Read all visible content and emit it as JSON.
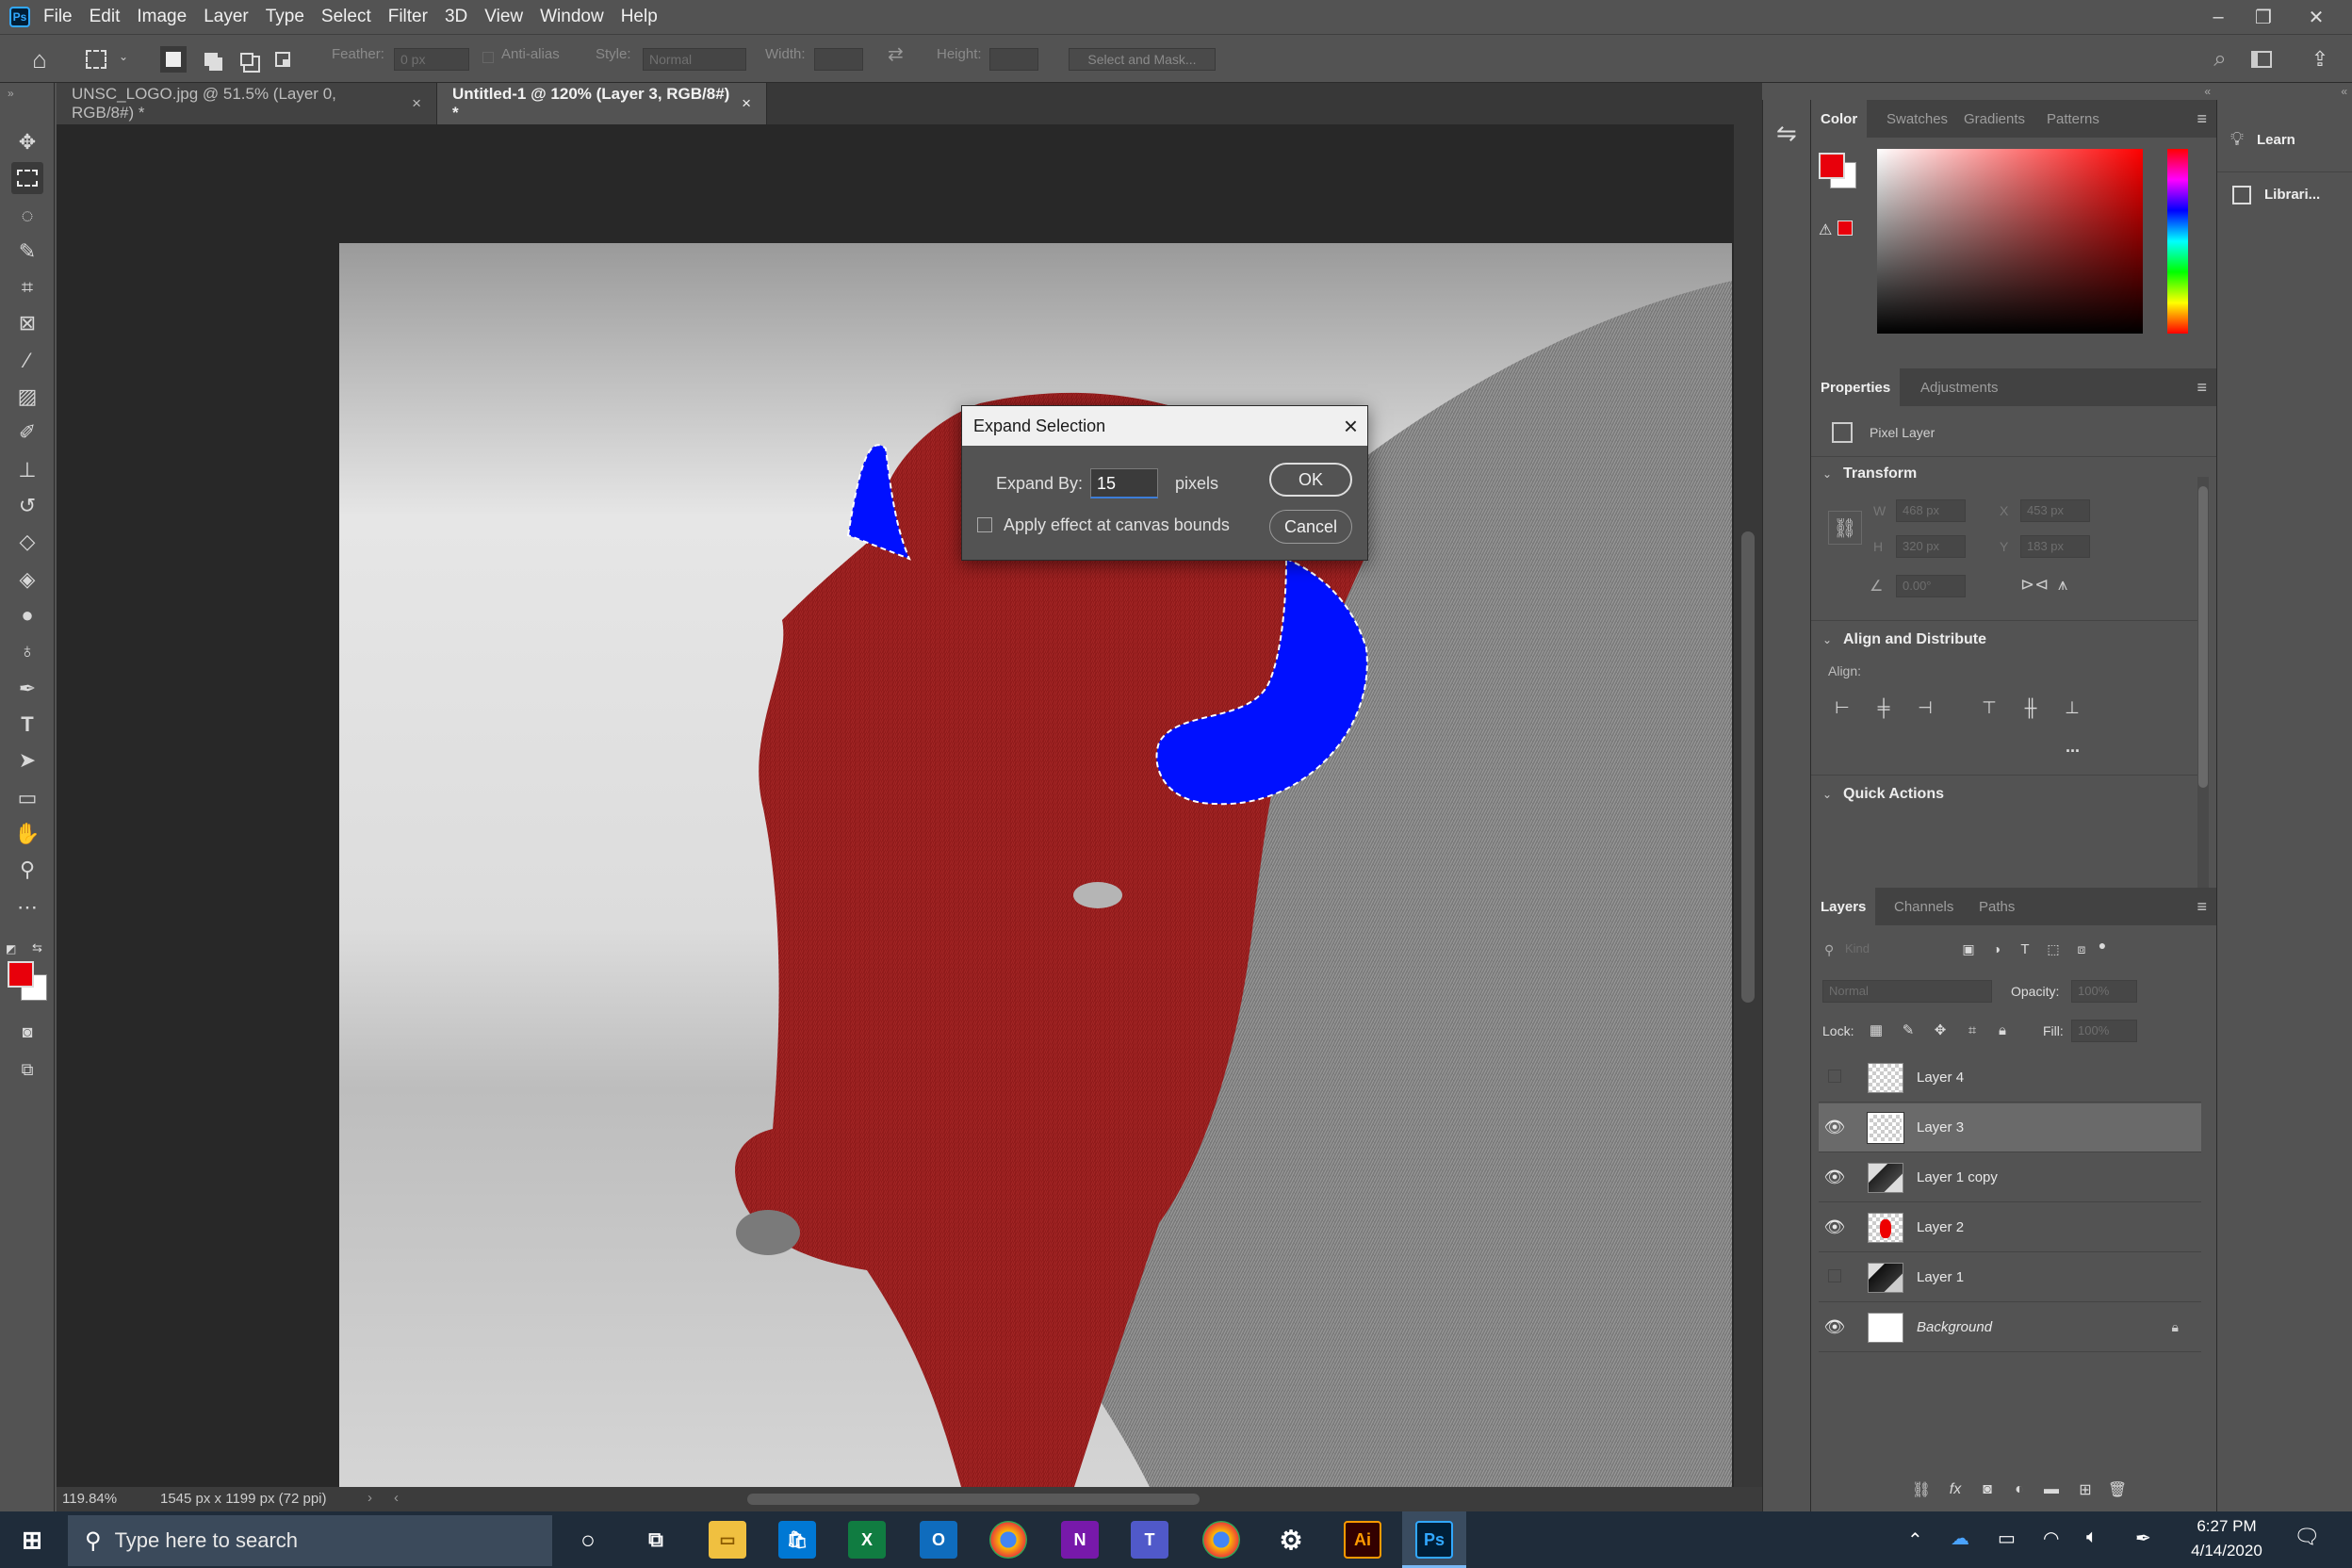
{
  "app": {
    "icon_text": "Ps"
  },
  "menu": [
    "File",
    "Edit",
    "Image",
    "Layer",
    "Type",
    "Select",
    "Filter",
    "3D",
    "View",
    "Window",
    "Help"
  ],
  "options": {
    "feather_label": "Feather:",
    "feather_value": "0 px",
    "antialias_label": "Anti-alias",
    "style_label": "Style:",
    "style_value": "Normal",
    "width_label": "Width:",
    "height_label": "Height:",
    "select_mask": "Select and Mask..."
  },
  "tabs": [
    {
      "label": "UNSC_LOGO.jpg @ 51.5% (Layer 0, RGB/8#) *",
      "close": "×"
    },
    {
      "label": "Untitled-1 @ 120% (Layer 3, RGB/8#) *",
      "close": "×"
    }
  ],
  "status": {
    "zoom": "119.84%",
    "doc_info": "1545 px x 1199 px (72 ppi)"
  },
  "dialog": {
    "title": "Expand Selection",
    "expand_label": "Expand By:",
    "expand_value": "15",
    "unit": "pixels",
    "checkbox_label": "Apply effect at canvas bounds",
    "ok": "OK",
    "cancel": "Cancel"
  },
  "color_panel": {
    "tabs": [
      "Color",
      "Swatches",
      "Gradients",
      "Patterns"
    ],
    "foreground": "#e8000b",
    "background": "#ffffff"
  },
  "properties": {
    "tabs": [
      "Properties",
      "Adjustments"
    ],
    "kind": "Pixel Layer",
    "transform": "Transform",
    "w_label": "W",
    "w": "468 px",
    "x_label": "X",
    "x": "453 px",
    "h_label": "H",
    "h": "320 px",
    "y_label": "Y",
    "y": "183 px",
    "angle": "0.00°",
    "align_title": "Align and Distribute",
    "align_label": "Align:",
    "more": "...",
    "quick_actions": "Quick Actions"
  },
  "layers_panel": {
    "tabs": [
      "Layers",
      "Channels",
      "Paths"
    ],
    "kind_placeholder": "Kind",
    "blend_mode": "Normal",
    "opacity_label": "Opacity:",
    "opacity": "100%",
    "lock_label": "Lock:",
    "fill_label": "Fill:",
    "fill": "100%",
    "layers": [
      {
        "name": "Layer 4",
        "visible": false,
        "selected": false
      },
      {
        "name": "Layer 3",
        "visible": true,
        "selected": true
      },
      {
        "name": "Layer 1 copy",
        "visible": true,
        "selected": false
      },
      {
        "name": "Layer 2",
        "visible": true,
        "selected": false
      },
      {
        "name": "Layer 1",
        "visible": false,
        "selected": false
      },
      {
        "name": "Background",
        "visible": true,
        "selected": false
      }
    ]
  },
  "right_strip": {
    "learn": "Learn",
    "libraries": "Librari..."
  },
  "taskbar": {
    "search_placeholder": "Type here to search",
    "time": "6:27 PM",
    "date": "4/14/2020"
  }
}
